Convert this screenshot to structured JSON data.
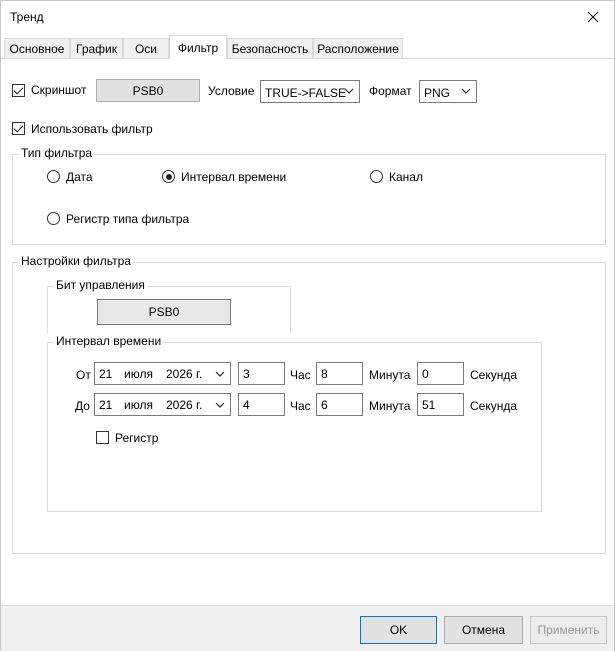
{
  "window": {
    "title": "Тренд"
  },
  "tabs": [
    {
      "label": "Основное"
    },
    {
      "label": "График"
    },
    {
      "label": "Оси"
    },
    {
      "label": "Фильтр"
    },
    {
      "label": "Безопасность"
    },
    {
      "label": "Расположение"
    }
  ],
  "screenshot": {
    "label": "Скриншот",
    "checked": true,
    "button_label": "PSB0",
    "condition_label": "Условие",
    "condition_value": "TRUE->FALSE",
    "format_label": "Формат",
    "format_value": "PNG"
  },
  "use_filter": {
    "label": "Использовать фильтр",
    "checked": true
  },
  "filter_type": {
    "title": "Тип фильтра",
    "options": [
      "Дата",
      "Интервал времени",
      "Канал",
      "Регистр типа фильтра"
    ],
    "selected": "Интервал времени"
  },
  "filter_settings": {
    "title": "Настройки фильтра",
    "control_bit": {
      "title": "Бит управления",
      "button_label": "PSB0"
    },
    "time_interval": {
      "title": "Интервал времени",
      "from": {
        "label": "От",
        "day": "21",
        "month": "июля",
        "year": "2026 г.",
        "hour": "3",
        "minute": "8",
        "second": "0"
      },
      "to": {
        "label": "До",
        "day": "21",
        "month": "июля",
        "year": "2026 г.",
        "hour": "4",
        "minute": "6",
        "second": "51"
      },
      "hour_label": "Час",
      "minute_label": "Минута",
      "second_label": "Секунда",
      "register_label": "Регистр",
      "register_checked": false
    }
  },
  "buttons": {
    "ok": "OK",
    "cancel": "Отмена",
    "apply": "Применить"
  },
  "colors": {
    "disabled_text": "#9a9a9a",
    "group_border": "#dcdcdc",
    "bottom_bar": "#f0f0f0"
  }
}
